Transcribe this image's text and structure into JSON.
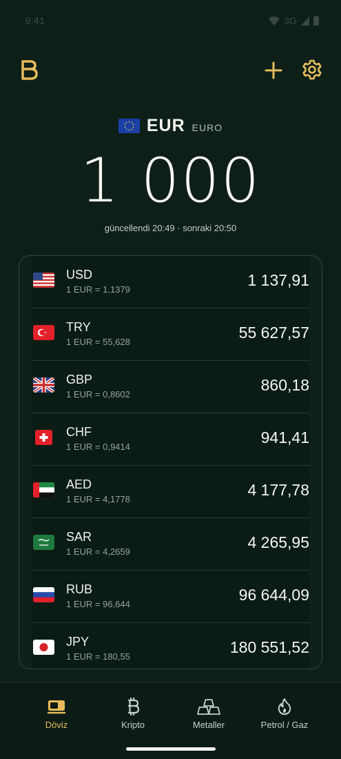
{
  "status_bar": {
    "time": "9:41",
    "network": "3G"
  },
  "header": {
    "logo_icon": "brand-b-icon",
    "add_icon": "plus-icon",
    "settings_icon": "gear-icon"
  },
  "base_currency": {
    "code": "EUR",
    "name": "EURO",
    "amount": "1 000",
    "updated": "güncellendi 20:49 · sonraki 20:50"
  },
  "rates": [
    {
      "code": "USD",
      "rate": "1 EUR = 1,1379",
      "value": "1 137,91"
    },
    {
      "code": "TRY",
      "rate": "1 EUR = 55,628",
      "value": "55 627,57"
    },
    {
      "code": "GBP",
      "rate": "1 EUR = 0,8602",
      "value": "860,18"
    },
    {
      "code": "CHF",
      "rate": "1 EUR = 0,9414",
      "value": "941,41"
    },
    {
      "code": "AED",
      "rate": "1 EUR = 4,1778",
      "value": "4 177,78"
    },
    {
      "code": "SAR",
      "rate": "1 EUR = 4,2659",
      "value": "4 265,95"
    },
    {
      "code": "RUB",
      "rate": "1 EUR = 96,644",
      "value": "96 644,09"
    },
    {
      "code": "JPY",
      "rate": "1 EUR = 180,55",
      "value": "180 551,52"
    }
  ],
  "nav": [
    {
      "label": "Döviz",
      "icon": "cash-icon",
      "active": true
    },
    {
      "label": "Kripto",
      "icon": "bitcoin-icon",
      "active": false
    },
    {
      "label": "Metaller",
      "icon": "gold-bars-icon",
      "active": false
    },
    {
      "label": "Petrol / Gaz",
      "icon": "flame-icon",
      "active": false
    }
  ],
  "colors": {
    "background": "#0e1f18",
    "accent": "#e7bd5c",
    "text": "#f2f2ee"
  }
}
